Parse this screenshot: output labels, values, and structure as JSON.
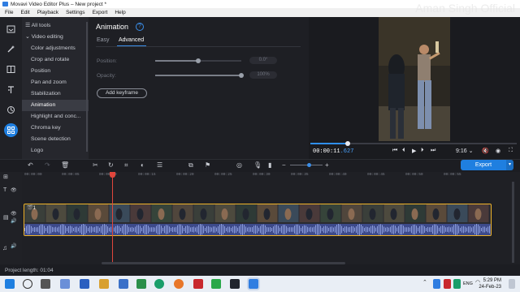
{
  "window": {
    "title": "Movavi Video Editor Plus – New project *",
    "watermark": "Aman Singh Official"
  },
  "menu": [
    "File",
    "Edit",
    "Playback",
    "Settings",
    "Export",
    "Help"
  ],
  "rail": {
    "icons": [
      "import-icon",
      "magic-wand-icon",
      "transitions-icon",
      "titles-icon",
      "stickers-icon",
      "more-tools-icon"
    ],
    "active_index": 5
  },
  "tools": {
    "header": "All tools",
    "group": "Video editing",
    "items": [
      "Color adjustments",
      "Crop and rotate",
      "Position",
      "Pan and zoom",
      "Stabilization",
      "Animation",
      "Highlight and conc...",
      "Chroma key",
      "Scene detection",
      "Logo"
    ],
    "active": "Animation"
  },
  "panel": {
    "title": "Animation",
    "tabs": [
      "Easy",
      "Advanced"
    ],
    "active_tab": "Advanced",
    "position_label": "Position:",
    "position_value": "0.0°",
    "position_level": 0.5,
    "opacity_label": "Opacity:",
    "opacity_value": "100%",
    "opacity_level": 1.0,
    "add_keyframe": "Add keyframe"
  },
  "player": {
    "timecode": "00:00:11",
    "timecode_frames": ".627",
    "progress": 0.18,
    "speed": "9:16"
  },
  "timeline": {
    "ticks": [
      "00:00:00",
      "00:00:05",
      "00:00:10",
      "00:00:15",
      "00:00:20",
      "00:00:25",
      "00:00:30",
      "00:00:35",
      "00:00:40",
      "00:00:45",
      "00:00:50",
      "00:00:55"
    ],
    "clip_badge": "1"
  },
  "export_label": "Export",
  "status": {
    "project_length": "Project length: 01:04"
  },
  "taskbar": {
    "lang": "ENG",
    "time": "5:29 PM",
    "date": "24-Feb-23"
  },
  "colors": {
    "accent": "#1f7fe0",
    "clip_border": "#f0b429",
    "playhead": "#e0463c"
  }
}
